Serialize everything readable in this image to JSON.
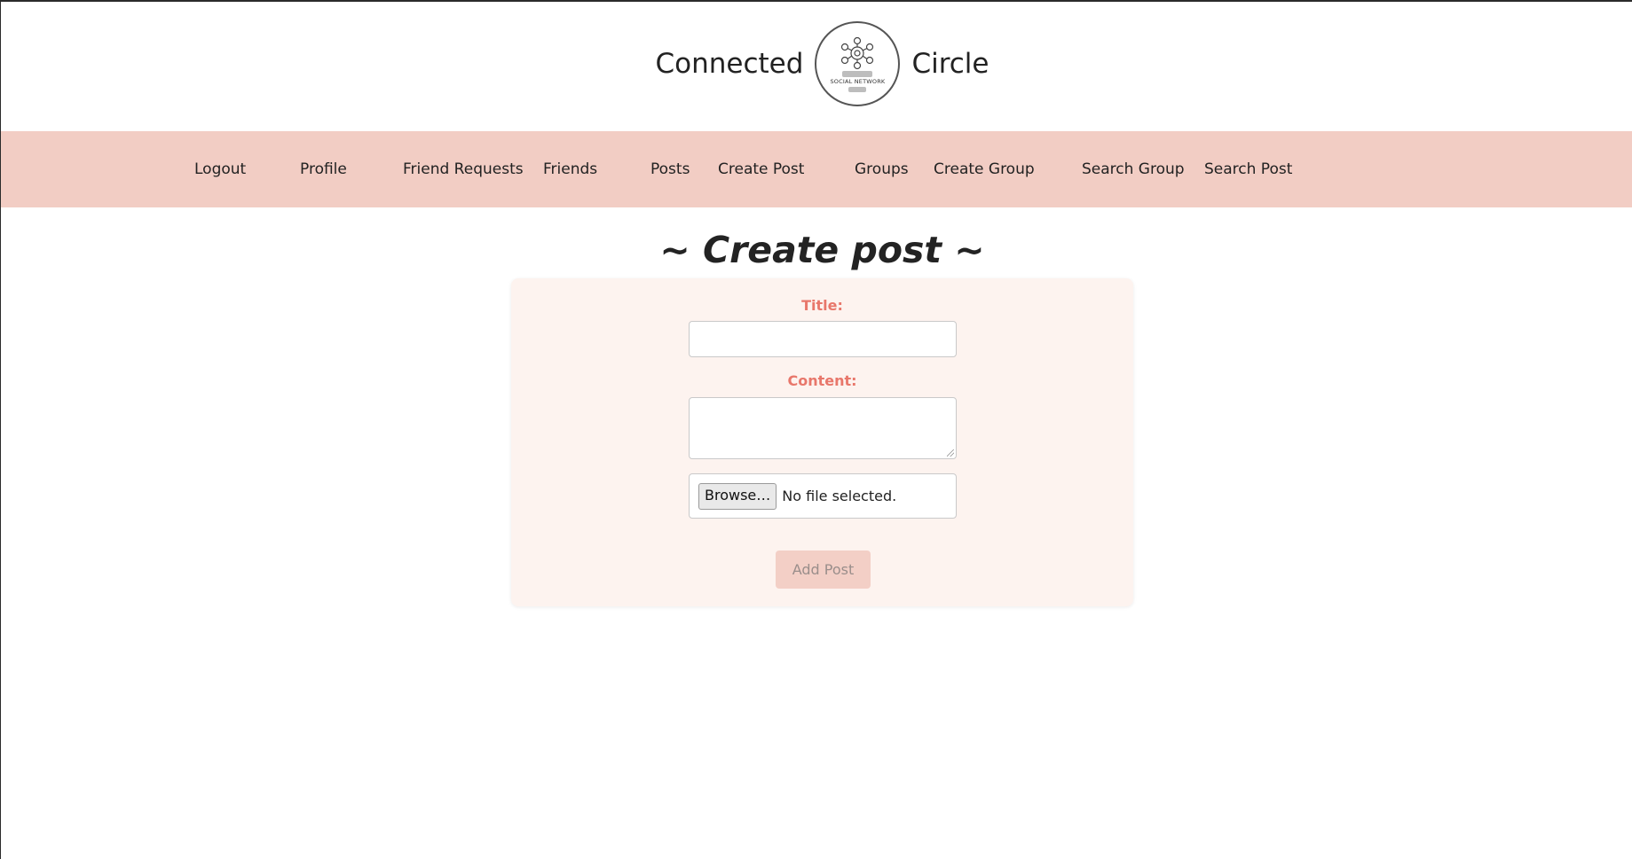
{
  "brand": {
    "left_word": "Connected",
    "right_word": "Circle",
    "logo_caption": "SOCIAL NETWORK"
  },
  "nav": {
    "items": [
      {
        "label": "Logout"
      },
      {
        "label": "Profile"
      },
      {
        "label": "Friend Requests"
      },
      {
        "label": "Friends"
      },
      {
        "label": "Posts"
      },
      {
        "label": "Create Post"
      },
      {
        "label": "Groups"
      },
      {
        "label": "Create Group"
      },
      {
        "label": "Search Group"
      },
      {
        "label": "Search Post"
      }
    ]
  },
  "page": {
    "title": "~ Create post ~"
  },
  "form": {
    "title_label": "Title:",
    "title_value": "",
    "content_label": "Content:",
    "content_value": "",
    "browse_label": "Browse…",
    "file_status": "No file selected.",
    "submit_label": "Add Post"
  },
  "colors": {
    "nav_background": "#f2cdc4",
    "card_background": "#fdf3ef",
    "label_color": "#e8776b",
    "button_background": "#f3cfc6"
  }
}
